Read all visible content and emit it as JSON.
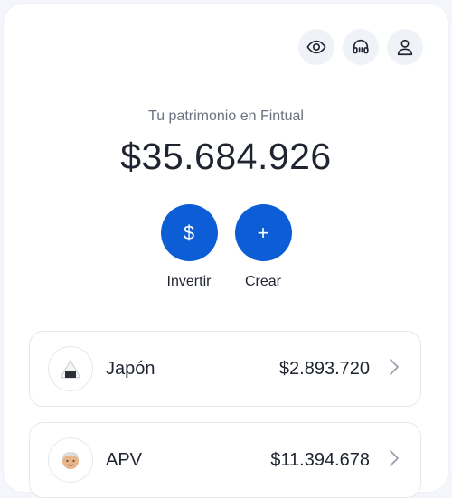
{
  "header": {
    "icons": [
      "eye-icon",
      "headset-icon",
      "user-icon"
    ]
  },
  "summary": {
    "subtitle": "Tu patrimonio en Fintual",
    "total": "$35.684.926"
  },
  "actions": [
    {
      "symbol": "$",
      "label": "Invertir"
    },
    {
      "symbol": "+",
      "label": "Crear"
    }
  ],
  "goals": [
    {
      "name": "Japón",
      "amount": "$2.893.720",
      "icon": "onigiri-icon"
    },
    {
      "name": "APV",
      "amount": "$11.394.678",
      "icon": "elderly-face-icon"
    }
  ],
  "colors": {
    "accent": "#0d5ed6",
    "icon_bg": "#eff2f7"
  }
}
